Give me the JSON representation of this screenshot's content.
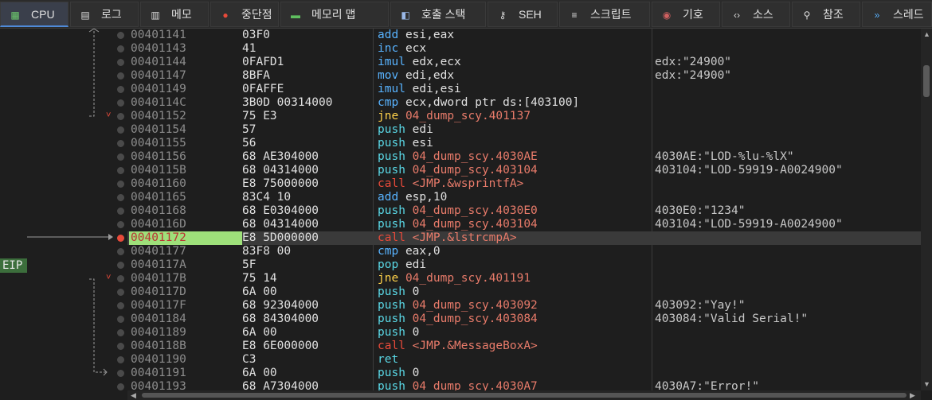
{
  "tabs": [
    {
      "label": "CPU",
      "icon": "cpu-icon",
      "active": true
    },
    {
      "label": "로그",
      "icon": "log-icon"
    },
    {
      "label": "메모",
      "icon": "notes-icon"
    },
    {
      "label": "중단점",
      "icon": "breakpoint-icon"
    },
    {
      "label": "메모리 맵",
      "icon": "memory-map-icon"
    },
    {
      "label": "호출 스택",
      "icon": "call-stack-icon"
    },
    {
      "label": "SEH",
      "icon": "seh-icon"
    },
    {
      "label": "스크립트",
      "icon": "script-icon"
    },
    {
      "label": "기호",
      "icon": "symbols-icon"
    },
    {
      "label": "소스",
      "icon": "source-icon"
    },
    {
      "label": "참조",
      "icon": "references-icon"
    },
    {
      "label": "스레드",
      "icon": "threads-icon"
    }
  ],
  "eip_label": "EIP",
  "colors": {
    "eip_highlight": "#9ee07a",
    "call": "#e84a3a",
    "push": "#5ad8e6",
    "jump": "#ffd24a",
    "arith": "#58b3ff"
  },
  "rows": [
    {
      "addr": "00401141",
      "bytes": "03F0",
      "mn": "add",
      "kind": "arith",
      "ops": "esi,eax",
      "cmt": ""
    },
    {
      "addr": "00401143",
      "bytes": "41",
      "mn": "inc",
      "kind": "arith",
      "ops": "ecx",
      "cmt": ""
    },
    {
      "addr": "00401144",
      "bytes": "0FAFD1",
      "mn": "imul",
      "kind": "arith",
      "ops": "edx,ecx",
      "cmt": "edx:\"24900\""
    },
    {
      "addr": "00401147",
      "bytes": "8BFA",
      "mn": "mov",
      "kind": "arith",
      "ops": "edi,edx",
      "cmt": "edx:\"24900\""
    },
    {
      "addr": "00401149",
      "bytes": "0FAFFE",
      "mn": "imul",
      "kind": "arith",
      "ops": "edi,esi",
      "cmt": ""
    },
    {
      "addr": "0040114C",
      "bytes": "3B0D 00314000",
      "mn": "cmp",
      "kind": "cmp",
      "ops": "ecx,dword ptr ds:[403100]",
      "cmt": ""
    },
    {
      "addr": "00401152",
      "bytes": "75 E3",
      "mn": "jne",
      "kind": "jmp",
      "ops": "04_dump_scy.401137",
      "cmt": ""
    },
    {
      "addr": "00401154",
      "bytes": "57",
      "mn": "push",
      "kind": "push",
      "ops": "edi",
      "cmt": ""
    },
    {
      "addr": "00401155",
      "bytes": "56",
      "mn": "push",
      "kind": "push",
      "ops": "esi",
      "cmt": ""
    },
    {
      "addr": "00401156",
      "bytes": "68 AE304000",
      "mn": "push",
      "kind": "push",
      "ops": "04_dump_scy.4030AE",
      "cmt": "4030AE:\"LOD-%lu-%lX\""
    },
    {
      "addr": "0040115B",
      "bytes": "68 04314000",
      "mn": "push",
      "kind": "push",
      "ops": "04_dump_scy.403104",
      "cmt": "403104:\"LOD-59919-A0024900\""
    },
    {
      "addr": "00401160",
      "bytes": "E8 75000000",
      "mn": "call",
      "kind": "call",
      "ops": "<JMP.&wsprintfA>",
      "cmt": ""
    },
    {
      "addr": "00401165",
      "bytes": "83C4 10",
      "mn": "add",
      "kind": "arith",
      "ops": "esp,10",
      "cmt": ""
    },
    {
      "addr": "00401168",
      "bytes": "68 E0304000",
      "mn": "push",
      "kind": "push",
      "ops": "04_dump_scy.4030E0",
      "cmt": "4030E0:\"1234\""
    },
    {
      "addr": "0040116D",
      "bytes": "68 04314000",
      "mn": "push",
      "kind": "push",
      "ops": "04_dump_scy.403104",
      "cmt": "403104:\"LOD-59919-A0024900\""
    },
    {
      "addr": "00401172",
      "bytes": "E8 5D000000",
      "mn": "call",
      "kind": "call",
      "ops": "<JMP.&lstrcmpA>",
      "cmt": "",
      "eip": true
    },
    {
      "addr": "00401177",
      "bytes": "83F8 00",
      "mn": "cmp",
      "kind": "cmp",
      "ops": "eax,0",
      "cmt": ""
    },
    {
      "addr": "0040117A",
      "bytes": "5F",
      "mn": "pop",
      "kind": "push",
      "ops": "edi",
      "cmt": ""
    },
    {
      "addr": "0040117B",
      "bytes": "75 14",
      "mn": "jne",
      "kind": "jmp",
      "ops": "04_dump_scy.401191",
      "cmt": ""
    },
    {
      "addr": "0040117D",
      "bytes": "6A 00",
      "mn": "push",
      "kind": "push",
      "ops": "0",
      "cmt": ""
    },
    {
      "addr": "0040117F",
      "bytes": "68 92304000",
      "mn": "push",
      "kind": "push",
      "ops": "04_dump_scy.403092",
      "cmt": "403092:\"Yay!\""
    },
    {
      "addr": "00401184",
      "bytes": "68 84304000",
      "mn": "push",
      "kind": "push",
      "ops": "04_dump_scy.403084",
      "cmt": "403084:\"Valid Serial!\""
    },
    {
      "addr": "00401189",
      "bytes": "6A 00",
      "mn": "push",
      "kind": "push",
      "ops": "0",
      "cmt": ""
    },
    {
      "addr": "0040118B",
      "bytes": "E8 6E000000",
      "mn": "call",
      "kind": "call",
      "ops": "<JMP.&MessageBoxA>",
      "cmt": ""
    },
    {
      "addr": "00401190",
      "bytes": "C3",
      "mn": "ret",
      "kind": "ret",
      "ops": "",
      "cmt": ""
    },
    {
      "addr": "00401191",
      "bytes": "6A 00",
      "mn": "push",
      "kind": "push",
      "ops": "0",
      "cmt": ""
    },
    {
      "addr": "00401193",
      "bytes": "68 A7304000",
      "mn": "push",
      "kind": "push",
      "ops": "04_dump_scy.4030A7",
      "cmt": "4030A7:\"Error!\""
    }
  ]
}
